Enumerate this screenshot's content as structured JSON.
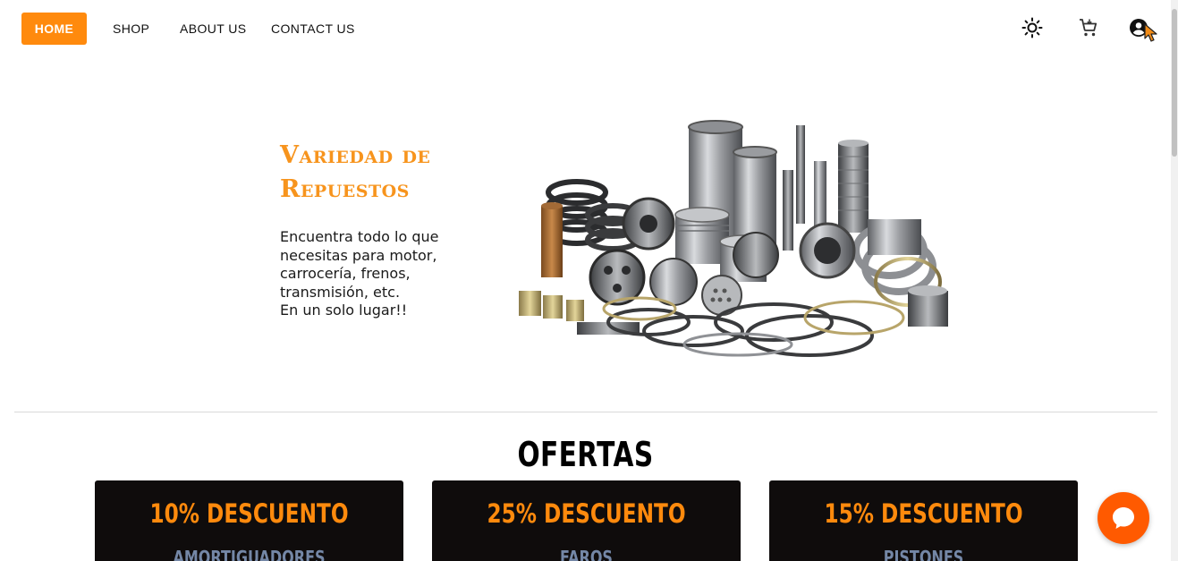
{
  "nav": {
    "items": [
      {
        "label": "HOME",
        "active": true
      },
      {
        "label": "SHOP",
        "active": false
      },
      {
        "label": "ABOUT US",
        "active": false
      },
      {
        "label": "CONTACT US",
        "active": false
      }
    ],
    "icons": [
      "sun-icon",
      "cart-icon",
      "account-icon"
    ],
    "accent_color": "#ff8a0d"
  },
  "hero": {
    "title_line1": "Variedad de",
    "title_line2": "Repuestos",
    "text_lines": [
      "Encuentra todo lo que",
      "necesitas para motor,",
      "carrocería, frenos,",
      "transmisión, etc.",
      "En un solo lugar!!"
    ],
    "title_color": "#f7941d"
  },
  "ofertas": {
    "title": "OFERTAS",
    "cards": [
      {
        "discount": "10% DESCUENTO",
        "category": "AMORTIGUADORES"
      },
      {
        "discount": "25% DESCUENTO",
        "category": "FAROS"
      },
      {
        "discount": "15% DESCUENTO",
        "category": "PISTONES"
      }
    ],
    "card_bg": "#0f0c0c",
    "discount_color": "#ff8a0d",
    "category_color": "#7487a6"
  },
  "chat": {
    "icon": "chat-bubble-icon",
    "color": "#ff5a00"
  }
}
